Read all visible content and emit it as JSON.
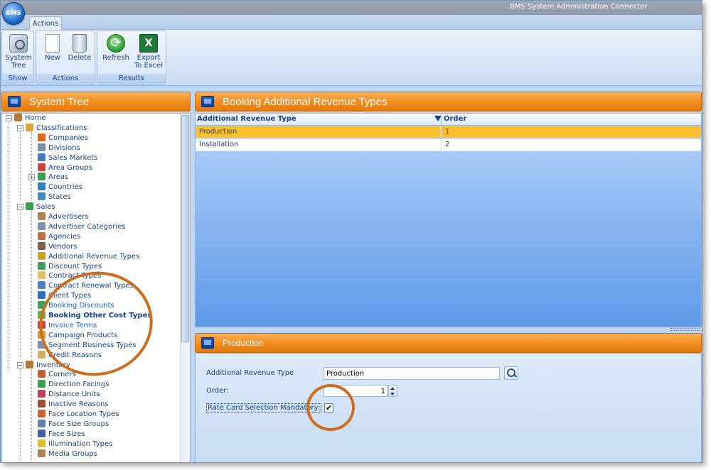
{
  "app": {
    "logo_text": "BMS",
    "title": "BMS System Administration Connector"
  },
  "ribbon": {
    "tab": "Actions",
    "groups": [
      {
        "label": "Show",
        "buttons": [
          {
            "label": "System\nTree",
            "icon": "system-tree-icon"
          }
        ]
      },
      {
        "label": "Actions",
        "buttons": [
          {
            "label": "New",
            "icon": "new-document-icon"
          },
          {
            "label": "Delete",
            "icon": "recycle-bin-icon"
          }
        ]
      },
      {
        "label": "Results",
        "buttons": [
          {
            "label": "Refresh",
            "icon": "refresh-icon"
          },
          {
            "label": "Export\nTo Excel",
            "icon": "excel-icon"
          }
        ]
      }
    ]
  },
  "tree": {
    "title": "System Tree",
    "nodes": [
      {
        "label": "Home",
        "icon_color": "#b07a3a"
      },
      {
        "label": "Classifications",
        "icon_color": "#d9a441"
      },
      {
        "label": "Companies",
        "icon_color": "#e06a1a"
      },
      {
        "label": "Divisions",
        "icon_color": "#7a8fa8"
      },
      {
        "label": "Sales Markets",
        "icon_color": "#4a78c0"
      },
      {
        "label": "Area Groups",
        "icon_color": "#d04040"
      },
      {
        "label": "Areas",
        "icon_color": "#3aa050"
      },
      {
        "label": "Countries",
        "icon_color": "#2f7fd0"
      },
      {
        "label": "States",
        "icon_color": "#3a90c0"
      },
      {
        "label": "Sales",
        "icon_color": "#3aa050"
      },
      {
        "label": "Advertisers",
        "icon_color": "#b08050"
      },
      {
        "label": "Advertiser Categories",
        "icon_color": "#8090b0"
      },
      {
        "label": "Agencies",
        "icon_color": "#c07040"
      },
      {
        "label": "Vendors",
        "icon_color": "#7a6050"
      },
      {
        "label": "Additional Revenue Types",
        "icon_color": "#d0a020"
      },
      {
        "label": "Discount Types",
        "icon_color": "#40a060"
      },
      {
        "label": "Contract Types",
        "icon_color": "#e0c060"
      },
      {
        "label": "Contract Renewal Types",
        "icon_color": "#5080c0"
      },
      {
        "label": "Client Types",
        "icon_color": "#3070c0"
      },
      {
        "label": "Booking Discounts",
        "icon_color": "#40a060"
      },
      {
        "label": "Booking Other Cost Types",
        "icon_color": "#60b040"
      },
      {
        "label": "Invoice Terms",
        "icon_color": "#c04040"
      },
      {
        "label": "Campaign Products",
        "icon_color": "#d0a030"
      },
      {
        "label": "Segment Business Types",
        "icon_color": "#8090b0"
      },
      {
        "label": "Credit Reasons",
        "icon_color": "#d0b060"
      },
      {
        "label": "Inventory",
        "icon_color": "#b07a3a"
      },
      {
        "label": "Corners",
        "icon_color": "#c06030"
      },
      {
        "label": "Direction Facings",
        "icon_color": "#3aa050"
      },
      {
        "label": "Distance Units",
        "icon_color": "#c04060"
      },
      {
        "label": "Inactive Reasons",
        "icon_color": "#a05030"
      },
      {
        "label": "Face Location Types",
        "icon_color": "#d06030"
      },
      {
        "label": "Face Size Groups",
        "icon_color": "#6080b0"
      },
      {
        "label": "Face Sizes",
        "icon_color": "#4060a0"
      },
      {
        "label": "Illumination Types",
        "icon_color": "#e0c020"
      },
      {
        "label": "Media Groups",
        "icon_color": "#b08050"
      }
    ]
  },
  "grid": {
    "title": "Booking Additional Revenue Types",
    "columns": [
      "Additional Revenue Type",
      "Order"
    ],
    "rows": [
      {
        "type": "Production",
        "order": "1"
      },
      {
        "type": "Installation",
        "order": "2"
      }
    ],
    "selected_color": "#fbc02d"
  },
  "detail": {
    "title": "Production",
    "fields": {
      "revenue_type_label": "Additional Revenue Type",
      "revenue_type_value": "Production",
      "order_label": "Order:",
      "order_value": "1",
      "rate_card_label": "Rate Card Selection Mandatory:",
      "rate_card_checked": "✔"
    }
  },
  "colors": {
    "accent_orange": "#f18b1b",
    "annotation_ring": "#cc6e1c",
    "text_blue": "#15428b"
  }
}
